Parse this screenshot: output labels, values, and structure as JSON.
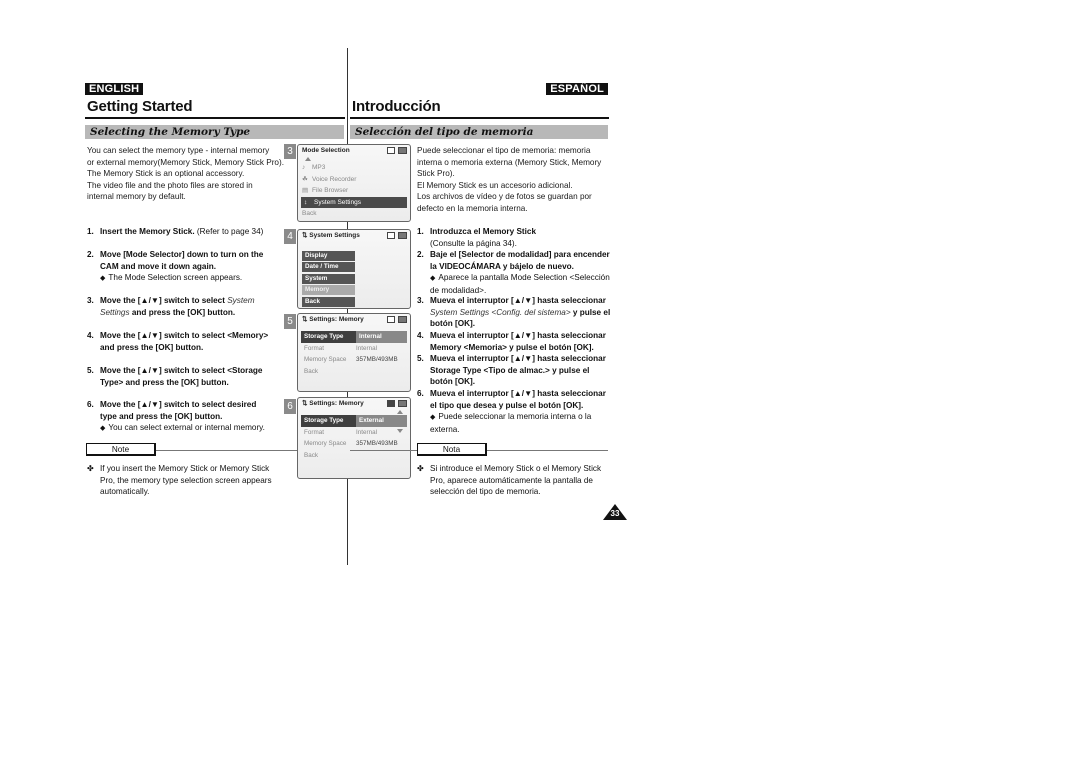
{
  "english": {
    "lang_badge": "ENGLISH",
    "title": "Getting Started",
    "section": "Selecting the Memory Type",
    "intro": "You can select the memory type - internal memory\nor external memory(Memory Stick, Memory Stick Pro).\nThe Memory Stick is an optional accessory.\nThe video file and the photo files are stored in\ninternal memory by default.",
    "steps": [
      {
        "num": "1.",
        "bold": "Insert the Memory Stick.",
        "normal": " (Refer to page 34)"
      },
      {
        "num": "2.",
        "bold": "Move [Mode Selector] down to turn on the CAM and move it down again.",
        "sub": "The Mode Selection screen appears."
      },
      {
        "num": "3.",
        "bold_a": "Move the [▲/▼] switch to select ",
        "italic": "System Settings",
        "bold_b": " and press the [OK] button."
      },
      {
        "num": "4.",
        "bold": "Move the [▲/▼] switch to select <Memory> and press the [OK] button."
      },
      {
        "num": "5.",
        "bold": "Move the [▲/▼] switch to select <Storage Type> and press the [OK] button."
      },
      {
        "num": "6.",
        "bold": "Move the [▲/▼] switch to select desired type and press the [OK] button.",
        "sub": "You can select external or internal memory."
      }
    ],
    "note_label": "Note",
    "note_text": "If you insert the Memory Stick or Memory Stick Pro, the memory type selection screen appears automatically."
  },
  "spanish": {
    "lang_badge": "ESPAÑOL",
    "title": "Introducción",
    "section": "Selección del tipo de memoria",
    "intro": "Puede seleccionar el tipo de memoria: memoria\ninterna o memoria externa (Memory Stick, Memory\nStick Pro).\nEl Memory Stick es un accesorio adicional.\nLos archivos de vídeo y de fotos se guardan por\ndefecto en la memoria interna.",
    "steps": [
      {
        "num": "1.",
        "bold": "Introduzca el Memory Stick",
        "normal": "(Consulte la página 34)."
      },
      {
        "num": "2.",
        "bold": "Baje el [Selector de modalidad] para encender la VIDEOCÁMARA y bájelo de nuevo.",
        "sub": "Aparece la pantalla Mode Selection <Selección de modalidad>."
      },
      {
        "num": "3.",
        "bold_a": "Mueva el interruptor [▲/▼] hasta seleccionar ",
        "italic": "System Settings <Config. del sistema>",
        "bold_b": " y pulse el botón [OK]."
      },
      {
        "num": "4.",
        "bold": "Mueva el interruptor [▲/▼] hasta seleccionar Memory <Memoria> y pulse el botón [OK]."
      },
      {
        "num": "5.",
        "bold": "Mueva el interruptor [▲/▼] hasta seleccionar Storage Type <Tipo de almac.> y pulse el botón [OK]."
      },
      {
        "num": "6.",
        "bold": "Mueva el interruptor [▲/▼] hasta seleccionar el tipo que desea y pulse el botón [OK].",
        "sub": "Puede seleccionar la memoria interna o la externa."
      }
    ],
    "note_label": "Nota",
    "note_text": "Si introduce el Memory Stick o el Memory Stick Pro, aparece automáticamente la pantalla de selección del tipo de memoria."
  },
  "screens": [
    {
      "num": "3",
      "title": "Mode Selection",
      "items": [
        {
          "icon": "♪",
          "label": "MP3"
        },
        {
          "icon": "☘",
          "label": "Voice Recorder"
        },
        {
          "icon": "▤",
          "label": "File Browser"
        },
        {
          "icon": "↕",
          "label": "System Settings",
          "selected": true
        },
        {
          "icon": "",
          "label": "Back"
        }
      ]
    },
    {
      "num": "4",
      "title": "System Settings",
      "items": [
        "Display",
        "Date / Time",
        "System",
        "Memory",
        "Back"
      ],
      "highlighted": "Memory"
    },
    {
      "num": "5",
      "title": "Settings: Memory",
      "rows": [
        {
          "key": "Storage Type",
          "value": "Internal",
          "selected": true
        },
        {
          "key": "Format",
          "value": "Internal"
        },
        {
          "key": "Memory Space",
          "value": "357MB/493MB"
        },
        {
          "key": "Back",
          "value": ""
        }
      ]
    },
    {
      "num": "6",
      "title": "Settings: Memory",
      "rows": [
        {
          "key": "Storage Type",
          "value": "External",
          "selected": true
        },
        {
          "key": "Format",
          "value": "Internal"
        },
        {
          "key": "Memory Space",
          "value": "357MB/493MB"
        },
        {
          "key": "Back",
          "value": ""
        }
      ]
    }
  ],
  "page_number": "33"
}
